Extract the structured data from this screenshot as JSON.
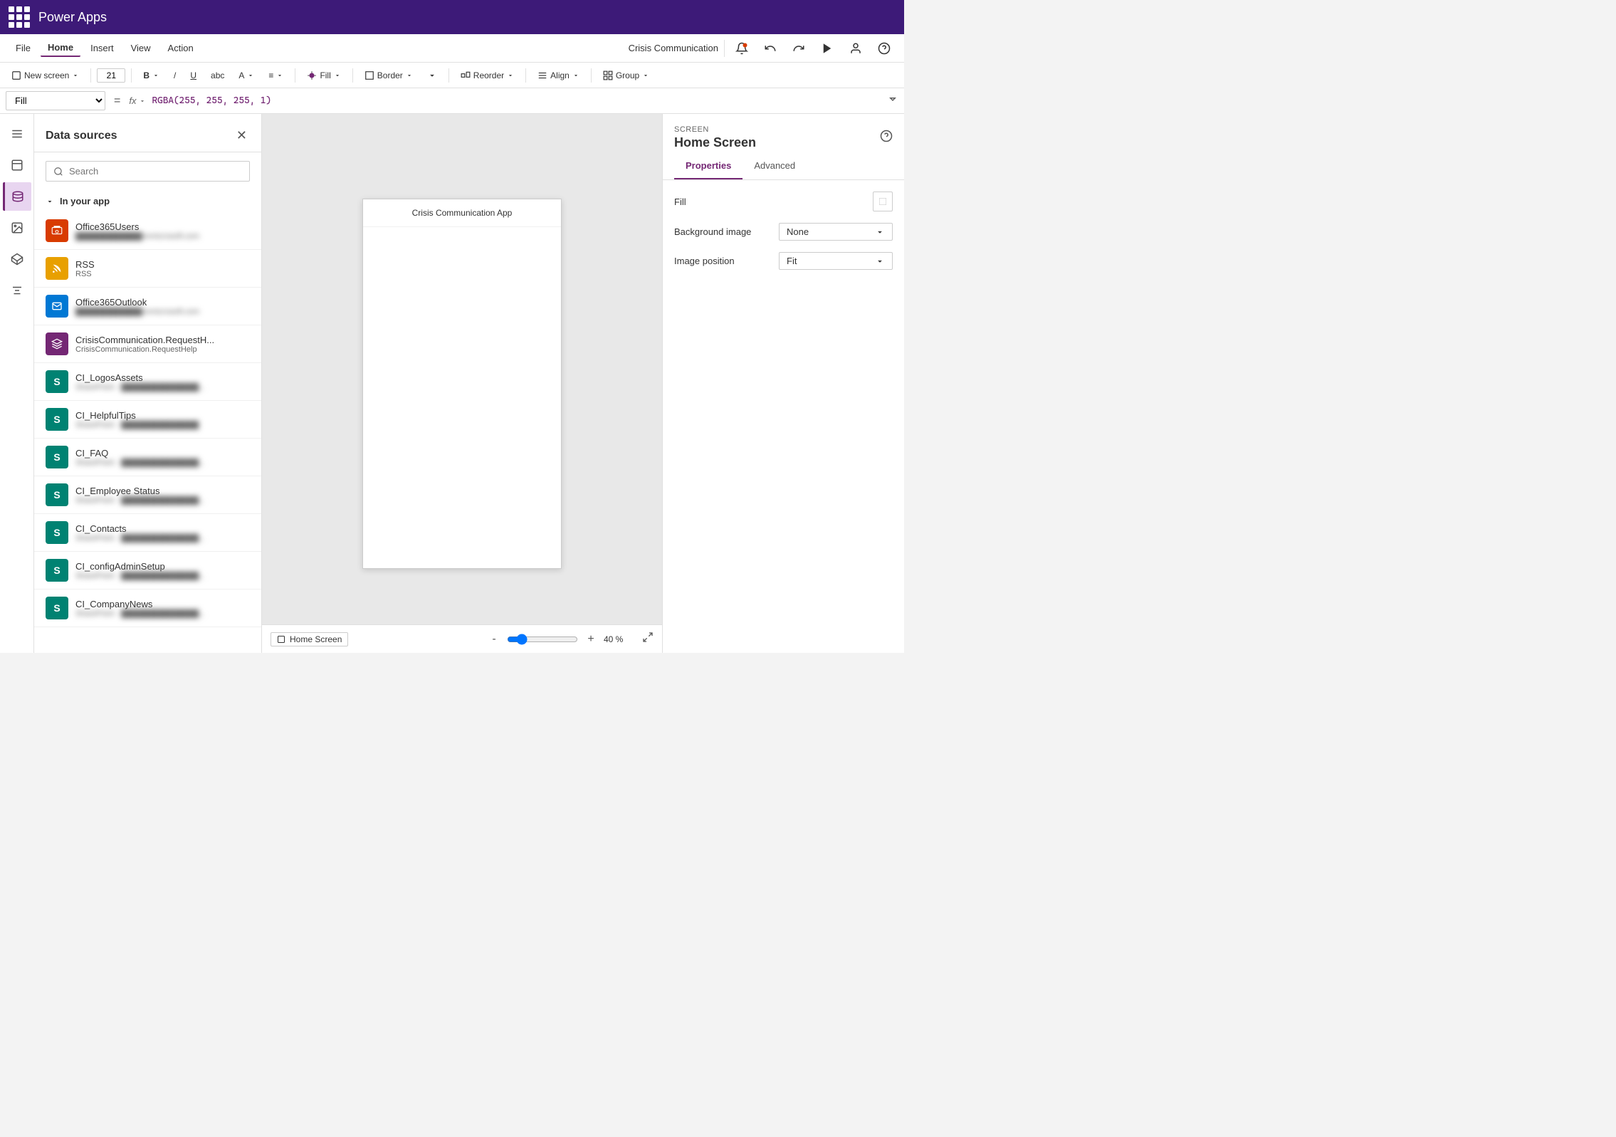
{
  "topbar": {
    "title": "Power Apps"
  },
  "menubar": {
    "items": [
      "File",
      "Home",
      "Insert",
      "View",
      "Action"
    ],
    "active": "Home",
    "app_name": "Crisis Communication"
  },
  "toolbar": {
    "new_screen": "New screen",
    "font_size": "21",
    "bold": "B",
    "strikethrough": "abc",
    "font": "A",
    "align": "≡",
    "fill": "Fill",
    "border": "Border",
    "reorder": "Reorder",
    "align_btn": "Align",
    "group": "Group"
  },
  "formulabar": {
    "property": "Fill",
    "fx": "fx",
    "formula": "RGBA(255,  255,  255,  1)"
  },
  "datasources": {
    "title": "Data sources",
    "search_placeholder": "Search",
    "section": "In your app",
    "items": [
      {
        "name": "Office365Users",
        "sub": "████████████onmicrosoft.com",
        "icon_type": "red",
        "icon_text": "O"
      },
      {
        "name": "RSS",
        "sub": "RSS",
        "icon_type": "orange",
        "icon_text": "R"
      },
      {
        "name": "Office365Outlook",
        "sub": "████████████onmicrosoft.com",
        "icon_type": "blue",
        "icon_text": "O"
      },
      {
        "name": "CrisisCommunication.RequestH...",
        "sub": "CrisisCommunication.RequestHelp",
        "icon_type": "purple",
        "icon_text": "C"
      },
      {
        "name": "CI_LogosAssets",
        "sub": "SharePoint · ██████████████...",
        "icon_type": "teal",
        "icon_text": "S"
      },
      {
        "name": "CI_HelpfulTips",
        "sub": "SharePoint · ██████████████",
        "icon_type": "teal",
        "icon_text": "S"
      },
      {
        "name": "CI_FAQ",
        "sub": "SharePoint · ██████████████...",
        "icon_type": "teal",
        "icon_text": "S"
      },
      {
        "name": "CI_Employee Status",
        "sub": "SharePoint · ██████████████...",
        "icon_type": "teal",
        "icon_text": "S"
      },
      {
        "name": "CI_Contacts",
        "sub": "SharePoint · ██████████████...",
        "icon_type": "teal",
        "icon_text": "S"
      },
      {
        "name": "CI_configAdminSetup",
        "sub": "SharePoint · ██████████████...",
        "icon_type": "teal",
        "icon_text": "S"
      },
      {
        "name": "CI_CompanyNews",
        "sub": "SharePoint · ██████████████...",
        "icon_type": "teal",
        "icon_text": "S"
      }
    ]
  },
  "canvas": {
    "app_title": "Crisis Communication App",
    "screen_name": "Home Screen",
    "zoom_value": "40 %",
    "zoom_min": "-",
    "zoom_max": "+"
  },
  "rightpanel": {
    "screen_label": "SCREEN",
    "screen_title": "Home Screen",
    "tabs": [
      "Properties",
      "Advanced"
    ],
    "active_tab": "Properties",
    "fill_label": "Fill",
    "background_image_label": "Background image",
    "background_image_value": "None",
    "image_position_label": "Image position",
    "image_position_value": "Fit"
  }
}
